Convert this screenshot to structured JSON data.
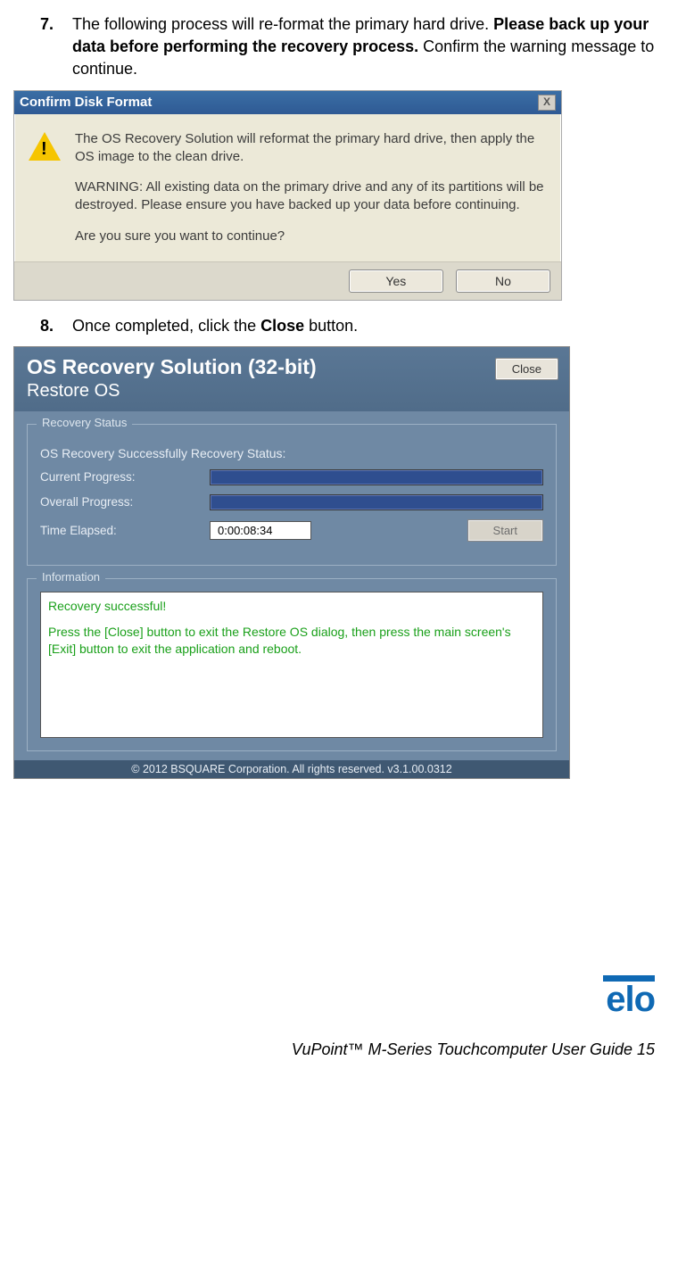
{
  "steps": {
    "s7": {
      "num": "7.",
      "text_a": "The following process will re-format the primary hard drive. ",
      "text_b": "Please back up your data before performing the recovery process.",
      "text_c": " Confirm the warning message to continue."
    },
    "s8": {
      "num": "8.",
      "text_a": "Once completed, click the ",
      "text_b": "Close",
      "text_c": " button."
    }
  },
  "dialog1": {
    "title": "Confirm Disk Format",
    "close_x": "X",
    "p1": "The OS Recovery Solution will reformat the primary hard drive, then apply the OS image to the clean drive.",
    "p2": "WARNING: All existing data on the primary drive and any of its partitions will be destroyed. Please ensure you have backed up your data before continuing.",
    "p3": "Are you sure you want to continue?",
    "yes": "Yes",
    "no": "No"
  },
  "dialog2": {
    "title1": "OS Recovery Solution (32-bit)",
    "title2": "Restore OS",
    "close": "Close",
    "group1": "Recovery Status",
    "status_line": "OS Recovery Successfully  Recovery Status:",
    "cur_prog": "Current Progress:",
    "ovr_prog": "Overall Progress:",
    "time_lbl": "Time Elapsed:",
    "time_val": "0:00:08:34",
    "start": "Start",
    "group2": "Information",
    "info1": "Recovery successful!",
    "info2": "Press the [Close] button to exit the Restore OS dialog, then press the main screen's [Exit] button to exit the application and reboot.",
    "footer": "© 2012 BSQUARE Corporation. All rights reserved. v3.1.00.0312"
  },
  "logo": "elo",
  "page_footer": "VuPoint™ M-Series Touchcomputer User Guide 15"
}
